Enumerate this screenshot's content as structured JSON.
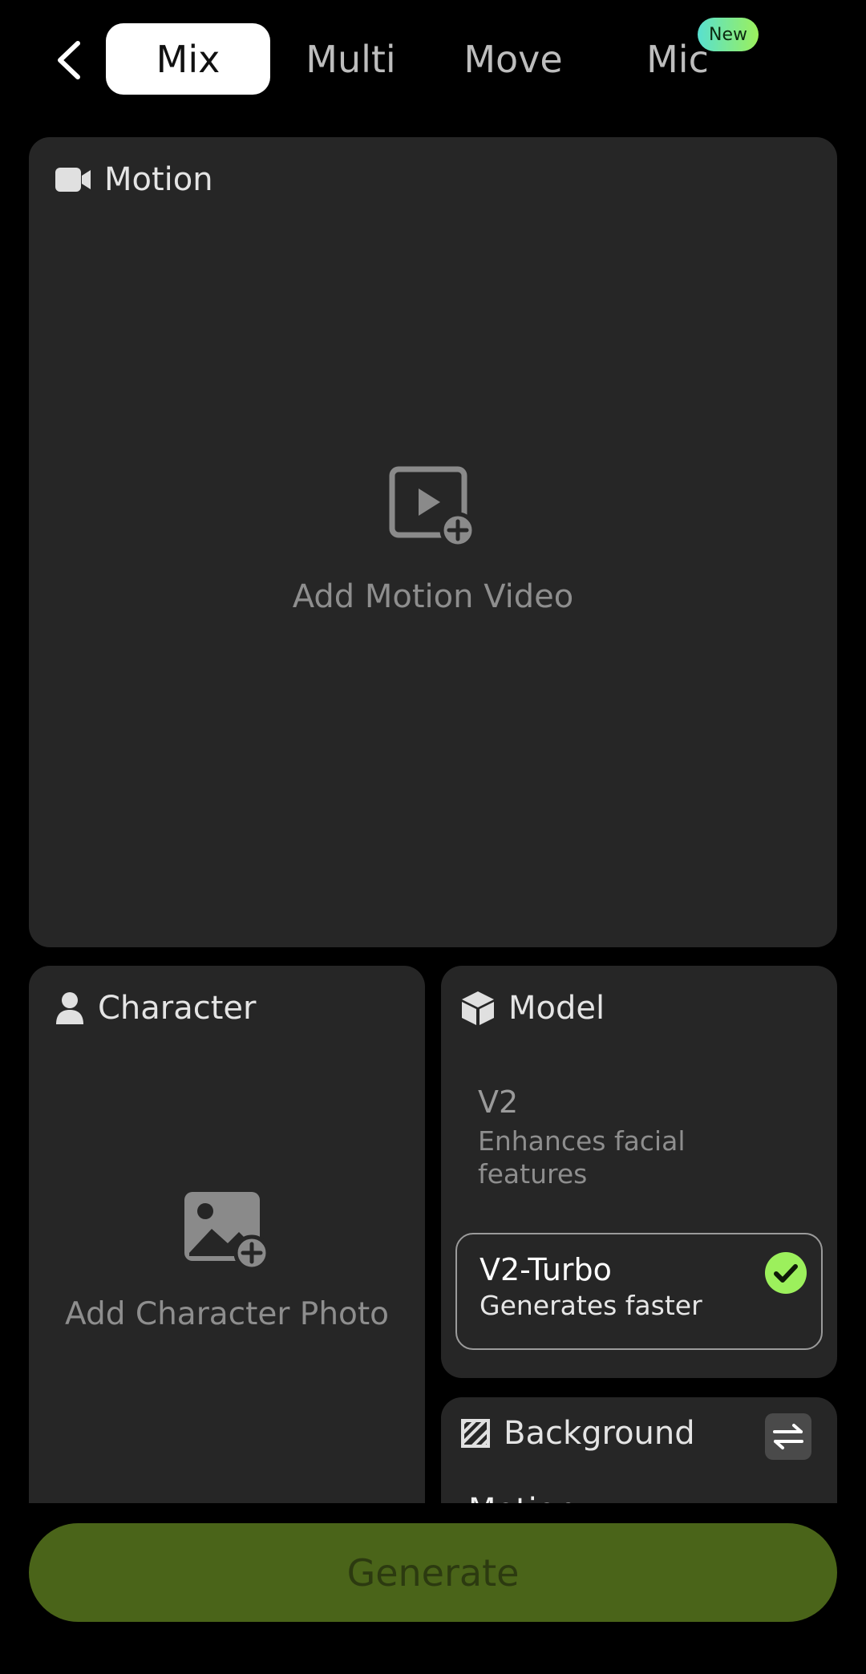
{
  "tabs": [
    {
      "label": "Mix",
      "active": true
    },
    {
      "label": "Multi",
      "active": false
    },
    {
      "label": "Move",
      "active": false
    },
    {
      "label": "Mic",
      "active": false,
      "badge": "New"
    }
  ],
  "motion": {
    "header": "Motion",
    "placeholder": "Add Motion Video"
  },
  "character": {
    "header": "Character",
    "placeholder": "Add Character Photo"
  },
  "model": {
    "header": "Model",
    "options": [
      {
        "title": "V2",
        "desc_line1": "Enhances facial",
        "desc_line2": "features",
        "selected": false
      },
      {
        "title": "V2-Turbo",
        "desc_line1": "Generates faster",
        "selected": true
      }
    ]
  },
  "background": {
    "header": "Background",
    "value": "Motion"
  },
  "generate": {
    "label": "Generate"
  },
  "colors": {
    "accent": "#9cf05c",
    "card_bg": "#262626",
    "generate_bg": "#4a6419"
  },
  "icons": {
    "back": "chevron-left-icon",
    "motion": "video-camera-icon",
    "character": "person-icon",
    "model": "cube-icon",
    "background": "hatched-square-icon",
    "swap": "swap-arrows-icon",
    "check": "check-circle-icon"
  }
}
